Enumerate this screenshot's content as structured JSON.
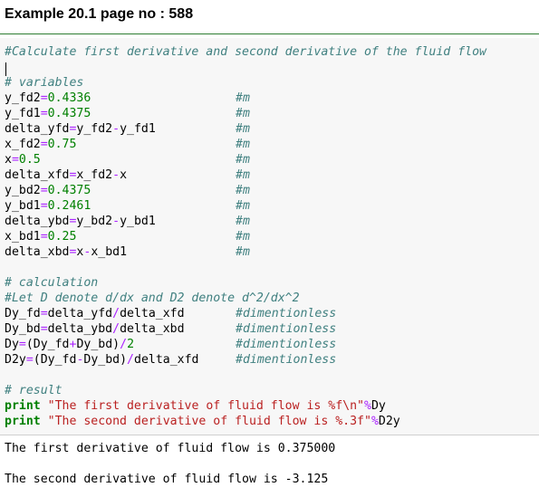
{
  "heading": "Example 20.1 page no : 588",
  "code": {
    "header_comment": "#Calculate first derivative and second derivative of the fluid flow",
    "vars_comment": "# variables",
    "unit_m": "#m",
    "unit_dimless": "#dimentionless",
    "v1_lhs": "y_fd2",
    "v1_val": "0.4336",
    "v2_lhs": "y_fd1",
    "v2_val": "0.4375",
    "v3_lhs": "delta_yfd",
    "v3_a": "y_fd2",
    "v3_op": "-",
    "v3_b": "y_fd1",
    "v4_lhs": "x_fd2",
    "v4_val": "0.75",
    "v5_lhs": "x",
    "v5_val": "0.5",
    "v6_lhs": "delta_xfd",
    "v6_a": "x_fd2",
    "v6_op": "-",
    "v6_b": "x",
    "v7_lhs": "y_bd2",
    "v7_val": "0.4375",
    "v8_lhs": "y_bd1",
    "v8_val": "0.2461",
    "v9_lhs": "delta_ybd",
    "v9_a": "y_bd2",
    "v9_op": "-",
    "v9_b": "y_bd1",
    "v10_lhs": "x_bd1",
    "v10_val": "0.25",
    "v11_lhs": "delta_xbd",
    "v11_a": "x",
    "v11_op": "-",
    "v11_b": "x_bd1",
    "calc_comment": "# calculation",
    "let_comment": "#Let D denote d/dx and D2 denote d^2/dx^2",
    "c1_lhs": "Dy_fd",
    "c1_a": "delta_yfd",
    "c1_op": "/",
    "c1_b": "delta_xfd",
    "c2_lhs": "Dy_bd",
    "c2_a": "delta_ybd",
    "c2_op": "/",
    "c2_b": "delta_xbd",
    "c3_lhs": "Dy",
    "c3_open": "(",
    "c3_a": "Dy_fd",
    "c3_op": "+",
    "c3_b": "Dy_bd",
    "c3_close": ")",
    "c3_div": "/",
    "c3_num": "2",
    "c4_lhs": "D2y",
    "c4_open": "(",
    "c4_a": "Dy_fd",
    "c4_op": "-",
    "c4_b": "Dy_bd",
    "c4_close": ")",
    "c4_div": "/",
    "c4_c": "delta_xfd",
    "result_comment": "# result",
    "print_kw": "print",
    "p1_str": "\"The first derivative of fluid flow is %f\\n\"",
    "p1_op": "%",
    "p1_var": "Dy",
    "p2_str": "\"The second derivative of fluid flow is %.3f\"",
    "p2_op": "%",
    "p2_var": "D2y",
    "eq": "="
  },
  "output": {
    "line1": "The first derivative of fluid flow is 0.375000",
    "line2": "The second derivative of fluid flow is -3.125"
  }
}
